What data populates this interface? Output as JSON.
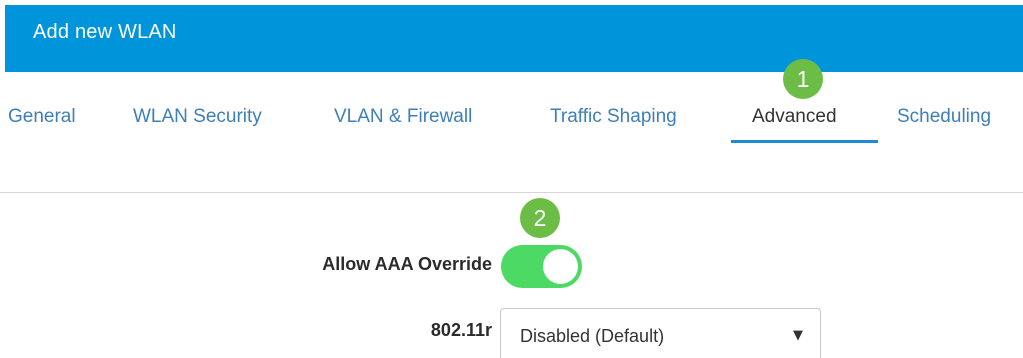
{
  "header": {
    "title": "Add new WLAN"
  },
  "tabs": [
    {
      "label": "General",
      "active": false
    },
    {
      "label": "WLAN Security",
      "active": false
    },
    {
      "label": "VLAN & Firewall",
      "active": false
    },
    {
      "label": "Traffic Shaping",
      "active": false
    },
    {
      "label": "Advanced",
      "active": true
    },
    {
      "label": "Scheduling",
      "active": false
    }
  ],
  "annotations": {
    "step1": "1",
    "step2": "2"
  },
  "advanced": {
    "aaa_override": {
      "label": "Allow AAA Override",
      "enabled": true
    },
    "dot11r": {
      "label": "802.11r",
      "selected": "Disabled (Default)",
      "arrow": "▼"
    }
  },
  "colors": {
    "header_bg": "#0095db",
    "tab_link": "#3d7fb8",
    "tab_active_underline": "#1f8ad6",
    "toggle_on": "#4cd964",
    "step_badge": "#6cbd45"
  }
}
